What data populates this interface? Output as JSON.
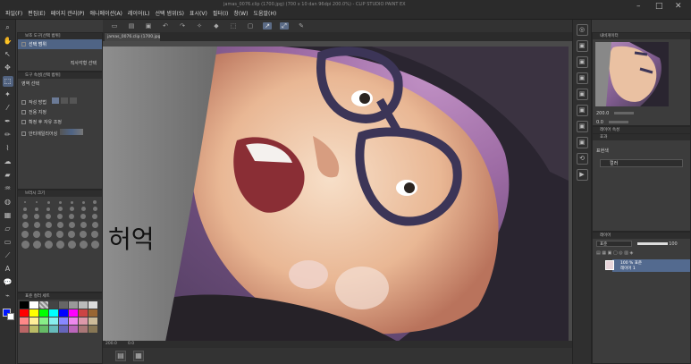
{
  "window": {
    "title": "jamas_0076.clip (1700.jpg) (700 x 10 dan 96dpi 200.0%) - CLIP STUDIO PAINT EX"
  },
  "menu": {
    "items": [
      "파일(F)",
      "편집(E)",
      "페이지 관리(P)",
      "애니메이션(A)",
      "레이어(L)",
      "선택 범위(S)",
      "표시(V)",
      "필터(I)",
      "창(W)",
      "도움말(H)"
    ]
  },
  "sub_tool_panel": {
    "header": "보조 도구[선택 범위]",
    "item_selected": "선택 범위",
    "option_label": "직사각형 선택"
  },
  "tool_property_panel": {
    "header": "도구 속성[선택 범위]",
    "title": "영역 선택",
    "row_mode": "작성 방법",
    "row_antialias": "안티에일리어싱",
    "row_after": "확정 후 자유 조정",
    "row_color_ops": "전용 지정"
  },
  "brush_size_panel": {
    "header": "브러시 크기"
  },
  "color_set_panel": {
    "header": "표준 컬러 세트",
    "main_color": "#0016ff",
    "sub_color": "#ffffff"
  },
  "canvas": {
    "tab_label": "jamas_0076.clip (1700.jpg)",
    "handwriting": "허억",
    "zoom": "200.0",
    "angle": "0.0"
  },
  "navigator": {
    "header": "내비게이터",
    "zoom": "200.0",
    "angle": "0.0"
  },
  "sub_view_panel": {
    "header": "레이어 속성"
  },
  "layer_property": {
    "header": "효과",
    "label": "표현색",
    "color_mode": "컬러"
  },
  "layer_panel": {
    "header": "레이어",
    "blend_mode": "표준",
    "opacity": "100",
    "layers": [
      {
        "name": "100 % 표준",
        "sub": "레이어 1"
      }
    ]
  },
  "colors": {
    "ui_bg": "#3a3a3a",
    "selection": "#4f6485",
    "panel_header": "#2d2d2d"
  }
}
